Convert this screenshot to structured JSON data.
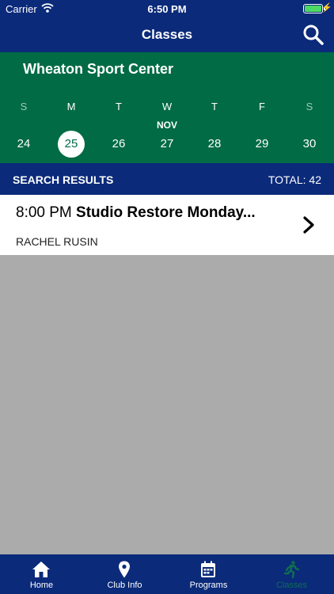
{
  "status_bar": {
    "carrier": "Carrier",
    "time": "6:50 PM",
    "battery_level": 1.0
  },
  "nav": {
    "title": "Classes"
  },
  "calendar": {
    "club_name": "Wheaton Sport Center",
    "month": "NOV",
    "days_of_week": [
      "S",
      "M",
      "T",
      "W",
      "T",
      "F",
      "S"
    ],
    "dates": [
      "24",
      "25",
      "26",
      "27",
      "28",
      "29",
      "30"
    ],
    "selected_date": "25"
  },
  "results": {
    "label": "SEARCH RESULTS",
    "total": "TOTAL: 42"
  },
  "classes": [
    {
      "time": "8:00 PM",
      "name": "Studio Restore Monday...",
      "instructor": "RACHEL RUSIN"
    }
  ],
  "tabs": [
    {
      "label": "Home",
      "icon": "home-icon"
    },
    {
      "label": "Club Info",
      "icon": "map-pin-icon"
    },
    {
      "label": "Programs",
      "icon": "calendar-icon"
    },
    {
      "label": "Classes",
      "icon": "runner-icon",
      "active": true
    }
  ],
  "colors": {
    "navy": "#0b2a7a",
    "green": "#006b45",
    "active_tab": "#0f6e4f",
    "battery": "#4cd964",
    "body_bg": "#ababab"
  }
}
